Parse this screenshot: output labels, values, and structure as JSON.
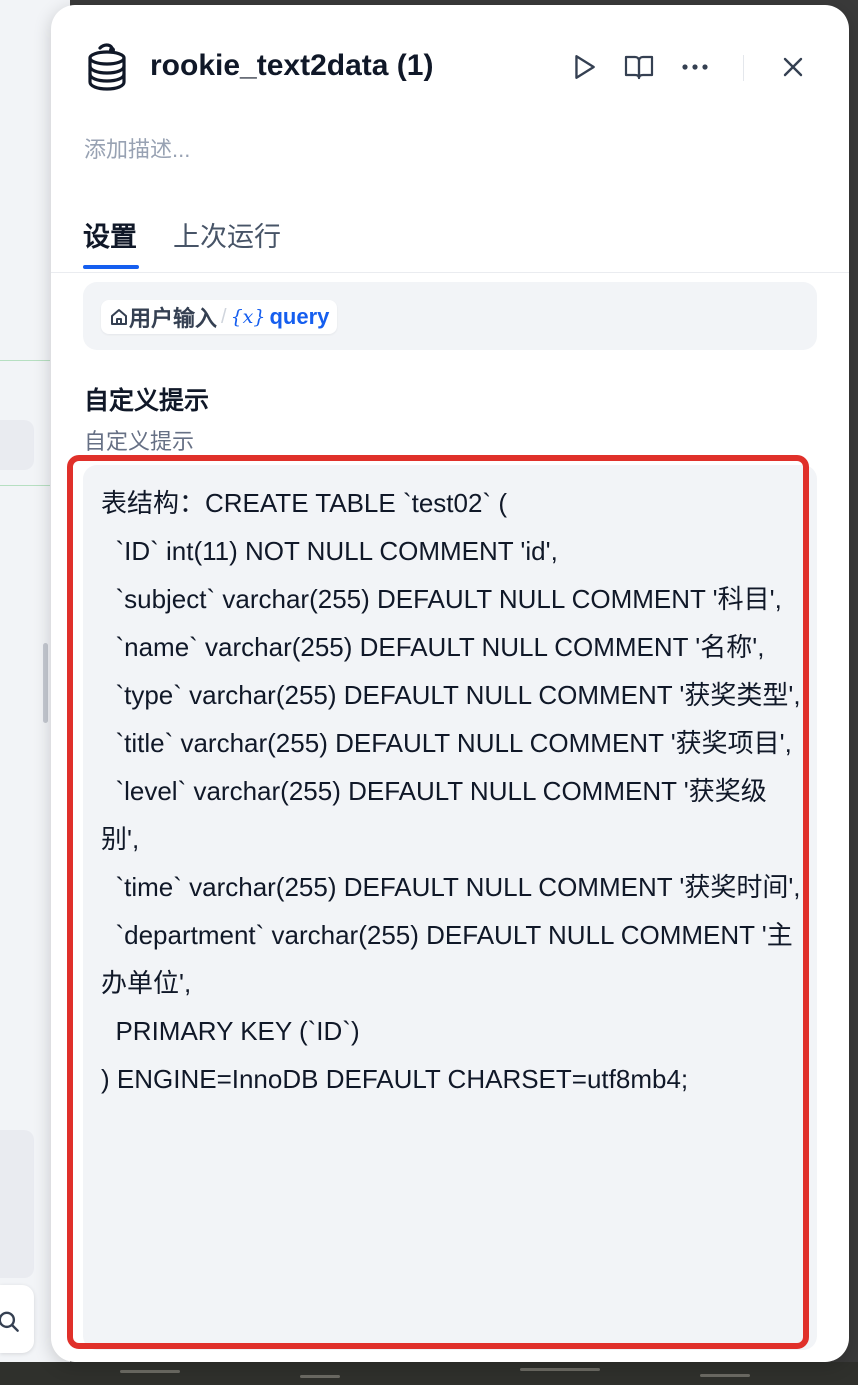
{
  "node": {
    "icon": "database-icon",
    "title": "rookie_text2data (1)",
    "description_placeholder": "添加描述..."
  },
  "header_actions": {
    "run_icon": "play-icon",
    "docs_icon": "book-open-icon",
    "more_icon": "more-horizontal-icon",
    "close_icon": "close-icon"
  },
  "tabs": [
    {
      "label": "设置",
      "active": true
    },
    {
      "label": "上次运行",
      "active": false
    }
  ],
  "input_variable": {
    "source_icon": "home-icon",
    "source_label": "用户输入",
    "separator": "/",
    "var_symbol": "{x}",
    "var_name": "query"
  },
  "custom_prompt": {
    "title": "自定义提示",
    "placeholder": "自定义提示",
    "value": "表结构：CREATE TABLE `test02` (\n  `ID` int(11) NOT NULL COMMENT 'id',\n  `subject` varchar(255) DEFAULT NULL COMMENT '科目',\n  `name` varchar(255) DEFAULT NULL COMMENT '名称',\n  `type` varchar(255) DEFAULT NULL COMMENT '获奖类型',\n  `title` varchar(255) DEFAULT NULL COMMENT '获奖项目',\n  `level` varchar(255) DEFAULT NULL COMMENT '获奖级别',\n  `time` varchar(255) DEFAULT NULL COMMENT '获奖时间',\n  `department` varchar(255) DEFAULT NULL COMMENT '主办单位',\n  PRIMARY KEY (`ID`)\n) ENGINE=InnoDB DEFAULT CHARSET=utf8mb4;"
  },
  "colors": {
    "accent": "#155eef",
    "highlight": "#e0302a"
  }
}
